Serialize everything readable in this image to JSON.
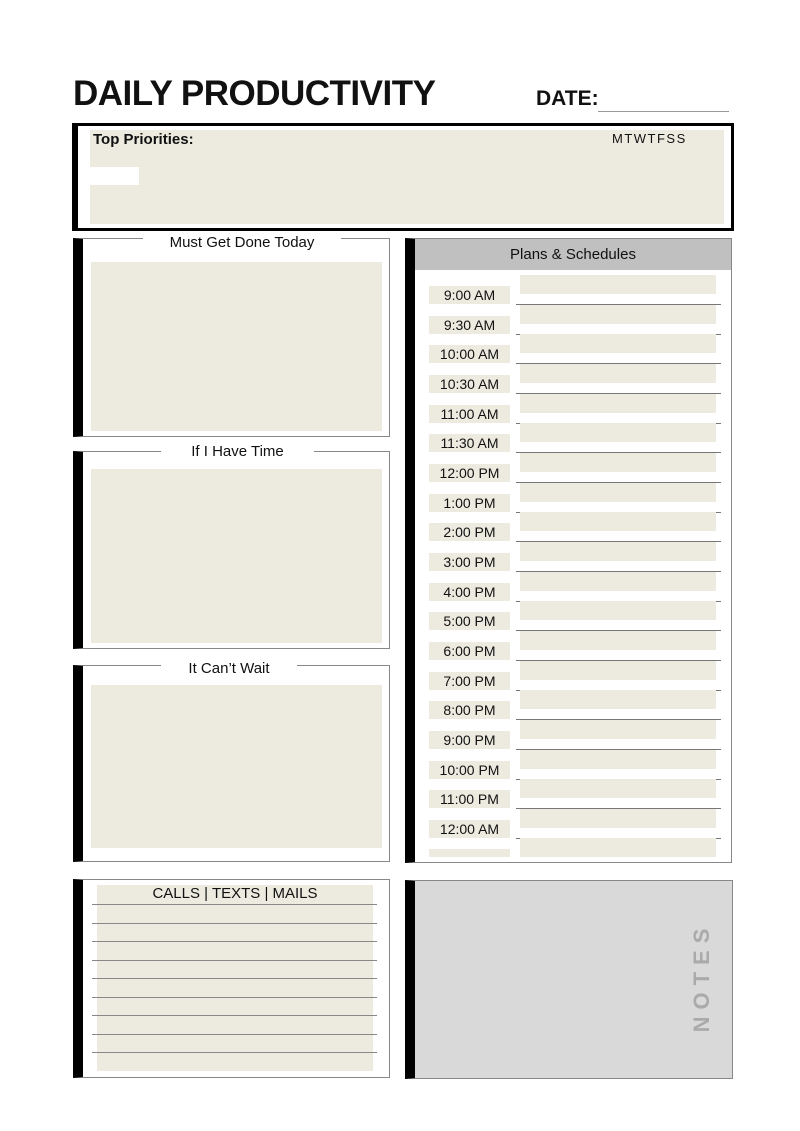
{
  "header": {
    "title": "DAILY PRODUCTIVITY",
    "date_label": "DATE:"
  },
  "top_priorities": {
    "label": "Top Priorities:",
    "days": "MTWTFSS"
  },
  "sections": {
    "must": "Must Get Done Today",
    "if_time": "If I Have Time",
    "cant_wait": "It Can’t Wait"
  },
  "schedule": {
    "title": "Plans & Schedules",
    "times": [
      "9:00 AM",
      "9:30 AM",
      "10:00 AM",
      "10:30 AM",
      "11:00 AM",
      "11:30 AM",
      "12:00 PM",
      "1:00 PM",
      "2:00 PM",
      "3:00 PM",
      "4:00 PM",
      "5:00 PM",
      "6:00 PM",
      "7:00 PM",
      "8:00 PM",
      "9:00 PM",
      "10:00 PM",
      "11:00 PM",
      "12:00 AM"
    ]
  },
  "calls": {
    "title": "CALLS | TEXTS | MAILS"
  },
  "notes": {
    "label": "NOTES"
  },
  "colors": {
    "beige": "#edebe0",
    "header_grey": "#c0c0c0",
    "notes_grey": "#d9d9d9",
    "bar": "#000000"
  }
}
